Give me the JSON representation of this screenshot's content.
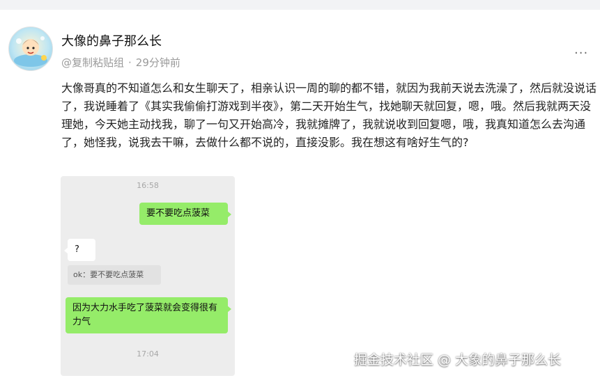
{
  "post": {
    "author_name": "大像的鼻子那么长",
    "source": "@复制粘贴组",
    "separator": "·",
    "time_ago": "29分钟前",
    "more_menu": "···",
    "content": "大像哥真的不知道怎么和女生聊天了，相亲认识一周的聊的都不错，就因为我前天说去洗澡了，然后就没说话了，我说睡着了《其实我偷偷打游戏到半夜》，第二天开始生气，找她聊天就回复，嗯，哦。然后我就两天没理她，今天她主动找我，聊了一句又开始高冷，我就摊牌了，我就说收到回复嗯，哦，我真知道怎么去沟通了，她怪我，说我去干嘛，去做什么都不说的，直接没影。我在想这有啥好生气的?"
  },
  "chat_screenshot": {
    "time_top": "16:58",
    "msg1": "要不要吃点菠菜",
    "msg2": "?",
    "quote": "ok：要不要吃点菠菜",
    "msg3": "因为大力水手吃了菠菜就会变得很有力气",
    "time_bottom": "17:04"
  },
  "watermark": "掘金技术社区 @ 大象的鼻子那么长",
  "colors": {
    "bubble_green": "#95ec69",
    "chat_background": "#ededed",
    "meta_gray": "#9a9a9a"
  }
}
